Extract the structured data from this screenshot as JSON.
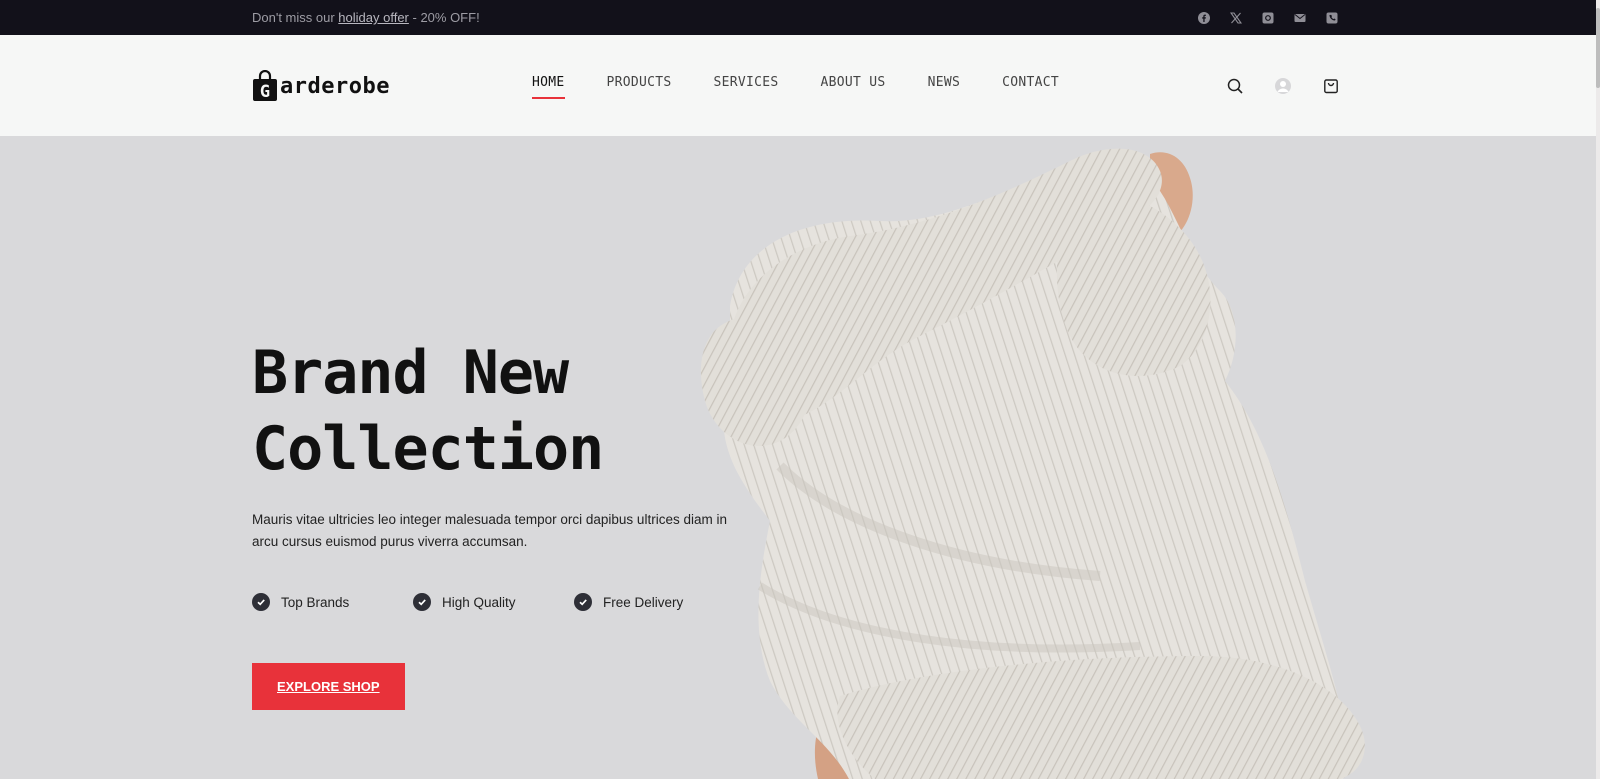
{
  "topbar": {
    "promo_prefix": "Don't miss our ",
    "promo_link": "holiday offer",
    "promo_suffix": " - 20% OFF!",
    "social_icons": [
      "facebook-icon",
      "x-twitter-icon",
      "instagram-icon",
      "email-icon",
      "phone-icon"
    ]
  },
  "header": {
    "logo_letter": "G",
    "logo_text": "arderobe",
    "nav": [
      {
        "label": "HOME",
        "active": true
      },
      {
        "label": "PRODUCTS",
        "active": false
      },
      {
        "label": "SERVICES",
        "active": false
      },
      {
        "label": "ABOUT US",
        "active": false
      },
      {
        "label": "NEWS",
        "active": false
      },
      {
        "label": "CONTACT",
        "active": false
      }
    ],
    "icons": [
      "search-icon",
      "user-avatar-icon",
      "shopping-bag-icon"
    ]
  },
  "hero": {
    "title_line1": "Brand New",
    "title_line2": "Collection",
    "description": "Mauris vitae ultricies leo integer malesuada tempor orci dapibus ultrices diam in arcu cursus euismod purus viverra accumsan.",
    "features": [
      "Top Brands",
      "High Quality",
      "Free Delivery"
    ],
    "cta_label": "EXPLORE SHOP"
  },
  "colors": {
    "topbar_bg": "#12111a",
    "header_bg": "#f6f7f6",
    "hero_bg": "#d9d9db",
    "accent": "#e8323a",
    "text_dark": "#111111"
  }
}
